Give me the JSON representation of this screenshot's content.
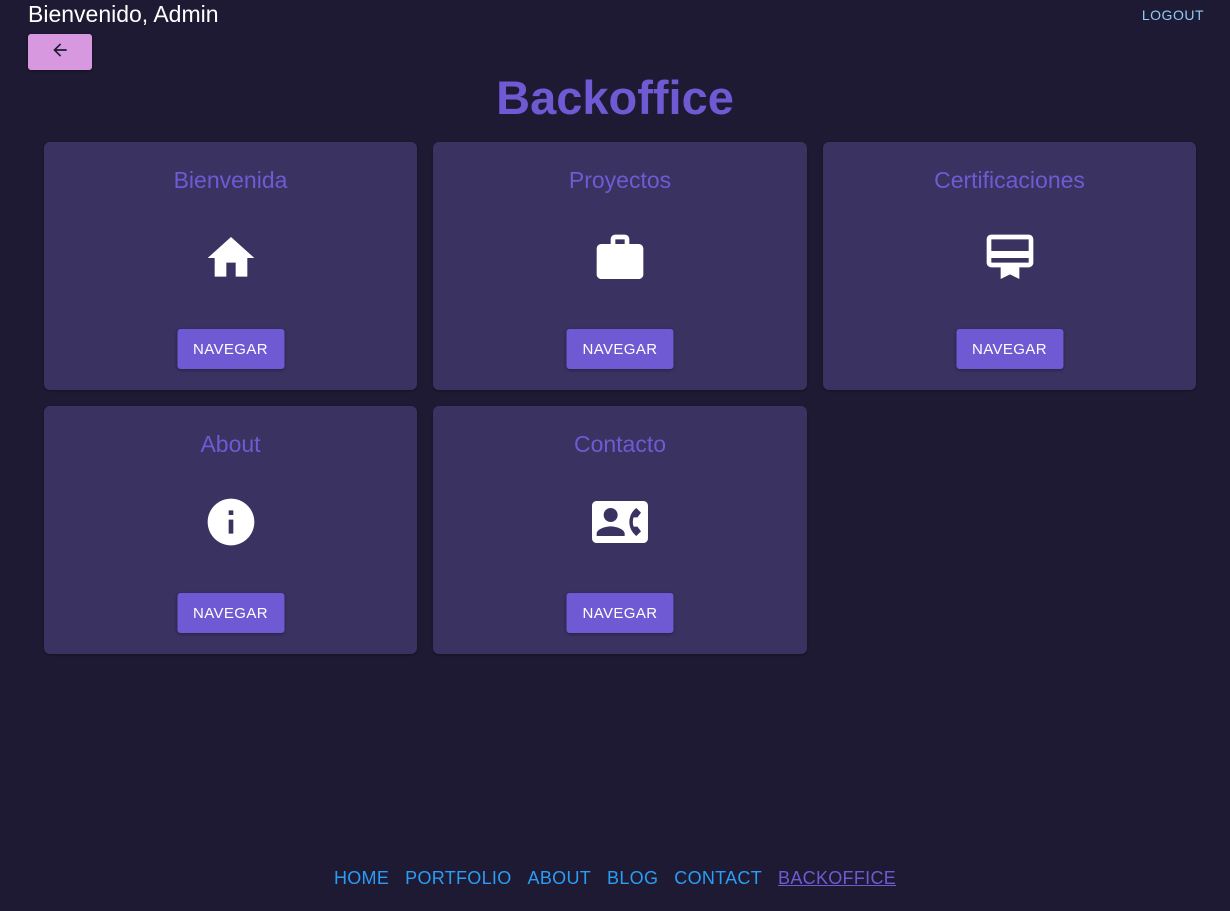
{
  "header": {
    "welcome": "Bienvenido, Admin",
    "logout": "LOGOUT",
    "back_icon": "arrow-left-icon"
  },
  "page": {
    "title": "Backoffice"
  },
  "cards": [
    {
      "title": "Bienvenida",
      "icon": "home-icon",
      "button": "NAVEGAR"
    },
    {
      "title": "Proyectos",
      "icon": "briefcase-icon",
      "button": "NAVEGAR"
    },
    {
      "title": "Certificaciones",
      "icon": "certificate-icon",
      "button": "NAVEGAR"
    },
    {
      "title": "About",
      "icon": "info-icon",
      "button": "NAVEGAR"
    },
    {
      "title": "Contacto",
      "icon": "contact-phone-icon",
      "button": "NAVEGAR"
    }
  ],
  "footer": {
    "links": [
      "HOME",
      "PORTFOLIO",
      "ABOUT",
      "BLOG",
      "CONTACT",
      "BACKOFFICE"
    ],
    "active": "BACKOFFICE"
  },
  "colors": {
    "background": "#1e1a33",
    "card": "#3a3261",
    "accent": "#6f5ad3",
    "back_button": "#d898e0",
    "link": "#2a9df4"
  }
}
